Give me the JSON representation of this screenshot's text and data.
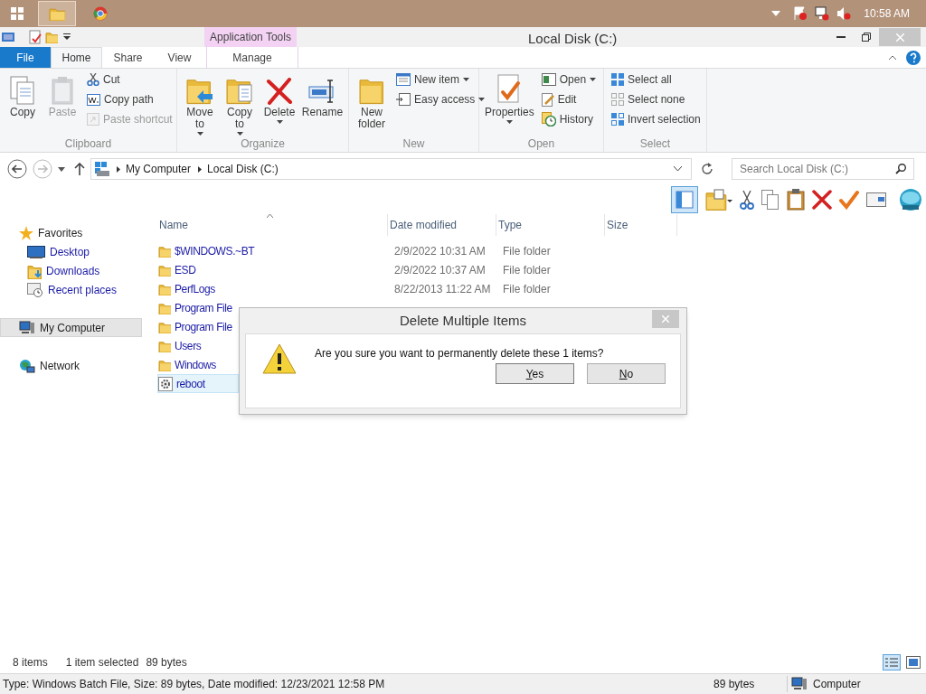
{
  "taskbar": {
    "clock": "10:58 AM"
  },
  "window": {
    "title": "Local Disk (C:)",
    "context_tab": "Application Tools"
  },
  "ribbon_tabs": [
    {
      "label": "File",
      "kind": "file",
      "selected": false
    },
    {
      "label": "Home",
      "kind": "tab",
      "selected": true
    },
    {
      "label": "Share",
      "kind": "tab",
      "selected": false
    },
    {
      "label": "View",
      "kind": "tab",
      "selected": false
    },
    {
      "label": "Manage",
      "kind": "context",
      "selected": false
    }
  ],
  "ribbon_groups": [
    {
      "name": "Clipboard",
      "items": [
        {
          "label": "Copy",
          "kind": "large",
          "disabled": false,
          "dropdown": false
        },
        {
          "label": "Paste",
          "kind": "large",
          "disabled": true,
          "dropdown": false
        },
        {
          "label": "Cut",
          "kind": "small",
          "disabled": false,
          "dropdown": false
        },
        {
          "label": "Copy path",
          "kind": "small",
          "disabled": false,
          "dropdown": false
        },
        {
          "label": "Paste shortcut",
          "kind": "small",
          "disabled": true,
          "dropdown": false
        }
      ]
    },
    {
      "name": "Organize",
      "items": [
        {
          "label": "Move to",
          "kind": "large",
          "disabled": false,
          "dropdown": true
        },
        {
          "label": "Copy to",
          "kind": "large",
          "disabled": false,
          "dropdown": true
        },
        {
          "label": "Delete",
          "kind": "large",
          "disabled": false,
          "dropdown": true
        },
        {
          "label": "Rename",
          "kind": "large",
          "disabled": false,
          "dropdown": false
        }
      ]
    },
    {
      "name": "New",
      "items": [
        {
          "label": "New folder",
          "kind": "large",
          "disabled": false,
          "dropdown": false
        },
        {
          "label": "New item",
          "kind": "small",
          "disabled": false,
          "dropdown": true
        },
        {
          "label": "Easy access",
          "kind": "small",
          "disabled": false,
          "dropdown": true
        }
      ]
    },
    {
      "name": "Open",
      "items": [
        {
          "label": "Properties",
          "kind": "large",
          "disabled": false,
          "dropdown": true
        },
        {
          "label": "Open",
          "kind": "small",
          "disabled": false,
          "dropdown": true
        },
        {
          "label": "Edit",
          "kind": "small",
          "disabled": false,
          "dropdown": false
        },
        {
          "label": "History",
          "kind": "small",
          "disabled": false,
          "dropdown": false
        }
      ]
    },
    {
      "name": "Select",
      "items": [
        {
          "label": "Select all",
          "kind": "small",
          "disabled": false,
          "dropdown": false
        },
        {
          "label": "Select none",
          "kind": "small",
          "disabled": false,
          "dropdown": false
        },
        {
          "label": "Invert selection",
          "kind": "small",
          "disabled": false,
          "dropdown": false
        }
      ]
    }
  ],
  "address": {
    "path": [
      "My Computer",
      "Local Disk (C:)"
    ],
    "search_placeholder": "Search Local Disk (C:)"
  },
  "sidebar": {
    "items": [
      {
        "label": "Favorites",
        "selected": false,
        "children": [
          {
            "label": "Desktop",
            "selected": false
          },
          {
            "label": "Downloads",
            "selected": false
          },
          {
            "label": "Recent places",
            "selected": false
          }
        ]
      },
      {
        "label": "My Computer",
        "selected": true
      },
      {
        "label": "Network",
        "selected": false
      }
    ]
  },
  "file_list": {
    "columns": [
      "Name",
      "Date modified",
      "Type",
      "Size"
    ],
    "rows": [
      {
        "name": "$WINDOWS.~BT",
        "date": "2/9/2022 10:31 AM",
        "type": "File folder",
        "kind": "folder",
        "selected": false
      },
      {
        "name": "ESD",
        "date": "2/9/2022 10:37 AM",
        "type": "File folder",
        "kind": "folder",
        "selected": false
      },
      {
        "name": "PerfLogs",
        "date": "8/22/2013 11:22 AM",
        "type": "File folder",
        "kind": "folder",
        "selected": false
      },
      {
        "name": "Program File",
        "kind": "folder",
        "selected": false
      },
      {
        "name": "Program File",
        "kind": "folder",
        "selected": false
      },
      {
        "name": "Users",
        "kind": "folder",
        "selected": false
      },
      {
        "name": "Windows",
        "kind": "folder",
        "selected": false
      },
      {
        "name": "reboot",
        "kind": "batch",
        "selected": true
      }
    ]
  },
  "status": {
    "count": "8 items",
    "selection": "1 item selected",
    "size": "89 bytes"
  },
  "details_bar": {
    "info": "Type: Windows Batch File, Size: 89 bytes, Date modified: 12/23/2021 12:58 PM",
    "size": "89 bytes",
    "zone": "Computer"
  },
  "dialog": {
    "title": "Delete Multiple Items",
    "message": "Are you sure you want to permanently delete these 1 items?",
    "buttons": [
      "Yes",
      "No"
    ]
  }
}
